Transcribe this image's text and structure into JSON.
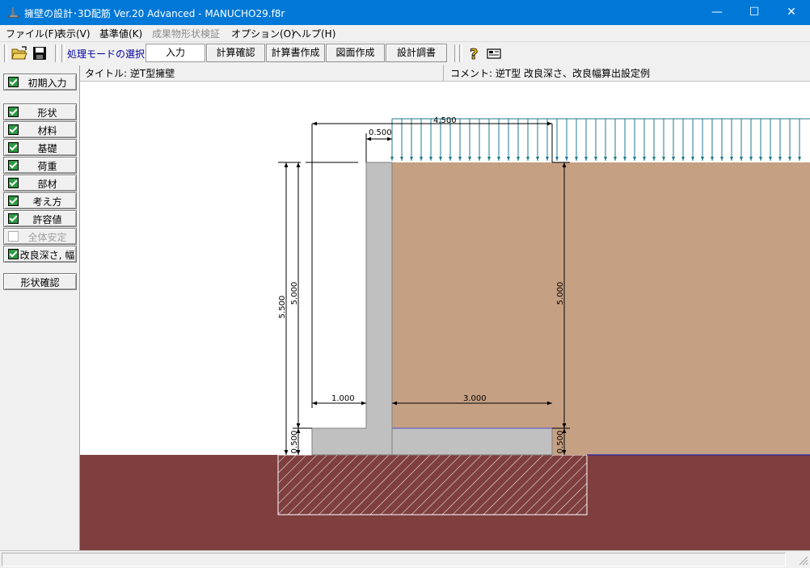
{
  "window": {
    "title": "擁壁の設計･3D配筋 Ver.20 Advanced  - MANUCHO29.f8r",
    "minimize": "—",
    "maximize": "☐",
    "close": "✕"
  },
  "menu": [
    {
      "label": "ファイル(F)",
      "enabled": true
    },
    {
      "label": "表示(V)",
      "enabled": true
    },
    {
      "label": "基準値(K)",
      "enabled": true
    },
    {
      "label": "成果物形状検証",
      "enabled": false
    },
    {
      "label": "オプション(O)",
      "enabled": true
    },
    {
      "label": "ヘルプ(H)",
      "enabled": true
    }
  ],
  "toolbar": {
    "mode_label": "処理モードの選択",
    "buttons": [
      "入力",
      "計算確認",
      "計算書作成",
      "図面作成",
      "設計調書"
    ],
    "icons": [
      "open-folder-icon",
      "save-icon",
      "help-icon",
      "calculator-icon"
    ]
  },
  "side_panel": {
    "initial": "初期入力",
    "items": [
      {
        "label": "形状",
        "checked": true,
        "enabled": true
      },
      {
        "label": "材料",
        "checked": true,
        "enabled": true
      },
      {
        "label": "基礎",
        "checked": true,
        "enabled": true
      },
      {
        "label": "荷重",
        "checked": true,
        "enabled": true
      },
      {
        "label": "部材",
        "checked": true,
        "enabled": true
      },
      {
        "label": "考え方",
        "checked": true,
        "enabled": true
      },
      {
        "label": "許容値",
        "checked": true,
        "enabled": true
      },
      {
        "label": "全体安定",
        "checked": false,
        "enabled": false
      },
      {
        "label": "改良深さ, 幅",
        "checked": true,
        "enabled": true
      }
    ],
    "shape_check": "形状確認"
  },
  "info": {
    "title": "タイトル: 逆T型擁壁",
    "comment": "コメント: 逆T型 改良深さ、改良幅算出設定例"
  },
  "drawing": {
    "dimensions": {
      "top_surcharge_width": "4.500",
      "stem_top_width": "0.500",
      "total_height": "5.500",
      "stem_height_left": "5.000",
      "stem_height_right": "5.000",
      "toe_length": "1.000",
      "heel_length": "3.000",
      "footing_thickness_left": "0.500",
      "footing_thickness_right": "0.500"
    },
    "colors": {
      "concrete": "#c0c0c0",
      "backfill_soil": "#c6a083",
      "ground": "#7f3f3f",
      "load_arrows": "#1f7a8c",
      "improvement_zone_hatch": "#ffffff"
    }
  }
}
